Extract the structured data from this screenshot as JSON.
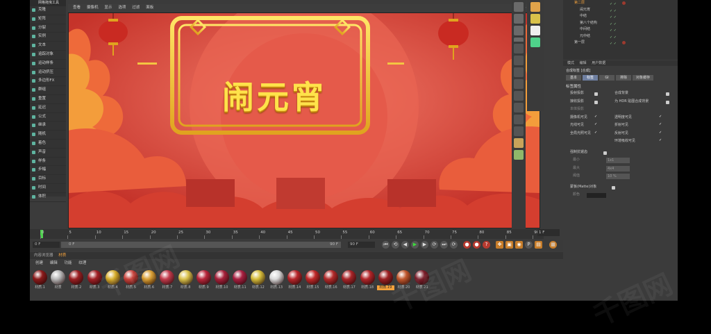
{
  "left_menu": {
    "title": "网格拖曳工具",
    "items": [
      "克隆",
      "矩阵",
      "分裂",
      "实例",
      "文本",
      "追踪对象",
      "运动样条",
      "运动挤压",
      "多边形FX",
      "群组",
      "重置",
      "延迟",
      "公式",
      "继承",
      "随机",
      "着色",
      "声音",
      "样条",
      "步幅",
      "目标",
      "时间",
      "体积"
    ]
  },
  "viewport": {
    "menu": [
      "查看",
      "摄像机",
      "显示",
      "选项",
      "过滤",
      "面板"
    ],
    "title_text": "闹元宵"
  },
  "object_manager": {
    "rows": [
      {
        "name": "第二层",
        "selected": true
      },
      {
        "name": "闹元宵",
        "selected": false
      },
      {
        "name": "中结",
        "selected": false
      },
      {
        "name": "第八个结构",
        "selected": false
      },
      {
        "name": "中间结",
        "selected": false
      },
      {
        "name": "元中结",
        "selected": false
      },
      {
        "name": "第一层",
        "selected": false
      }
    ]
  },
  "attributes": {
    "header_tabs": [
      "模式",
      "编辑",
      "用户数据"
    ],
    "title": "合成标签 [合成]",
    "tabs": [
      "基本",
      "标签",
      "GI",
      "排除",
      "对象缓存"
    ],
    "section": "标签属性",
    "left_props": [
      "投射投影",
      "接收投影",
      "本体投影",
      "摄像机可见",
      "光线可见",
      "全局光照可见"
    ],
    "right_props": [
      "合成背景",
      "为 HDR 贴图合成背景",
      "透明度可见",
      "折射可见",
      "反射可见",
      "环境吸收可见"
    ],
    "lower_props": [
      "强制抗锯齿",
      "最小",
      "最大",
      "阈值"
    ],
    "lower_values": [
      "1x1",
      "4x4",
      "10 %"
    ],
    "matte_label": "蒙板(Matte)对象",
    "color_label": "颜色"
  },
  "timeline": {
    "ticks": [
      "0",
      "5",
      "10",
      "15",
      "20",
      "25",
      "30",
      "35",
      "40",
      "45",
      "50",
      "55",
      "60",
      "65",
      "70",
      "75",
      "80",
      "85",
      "90"
    ],
    "frame_field": "1 F",
    "start_field": "0 F",
    "range_start": "0 F",
    "range_end": "90 F",
    "end_field": "90 F"
  },
  "material_manager": {
    "tabs": [
      "内容浏览器",
      "材质"
    ],
    "menu": [
      "创建",
      "编辑",
      "功能",
      "纹理"
    ],
    "materials": [
      {
        "name": "材质.1",
        "color": "#8b1a1a"
      },
      {
        "name": "材质",
        "color": "#b8b8b8"
      },
      {
        "name": "材质.2",
        "color": "#9b1f22"
      },
      {
        "name": "材质.3",
        "color": "#a11f25"
      },
      {
        "name": "材质.4",
        "color": "#d7ad2a"
      },
      {
        "name": "材质.5",
        "color": "#c9413a"
      },
      {
        "name": "材质.6",
        "color": "#d89b2b"
      },
      {
        "name": "材质.7",
        "color": "#c33a4b"
      },
      {
        "name": "材质.8",
        "color": "#d9c14a"
      },
      {
        "name": "材质.9",
        "color": "#b8253a"
      },
      {
        "name": "材质.10",
        "color": "#a6203a"
      },
      {
        "name": "材质.11",
        "color": "#a81f40"
      },
      {
        "name": "材质.12",
        "color": "#d6bd3a"
      },
      {
        "name": "材质.13",
        "color": "#d9d9d9"
      },
      {
        "name": "材质.14",
        "color": "#b8252a"
      },
      {
        "name": "材质.15",
        "color": "#c02828"
      },
      {
        "name": "材质.16",
        "color": "#b22a2a"
      },
      {
        "name": "材质.17",
        "color": "#a82428"
      },
      {
        "name": "材质.18",
        "color": "#b22529"
      },
      {
        "name": "材质.19",
        "color": "#9c2023"
      },
      {
        "name": "材质.20",
        "color": "#c1572c"
      },
      {
        "name": "材质.21",
        "color": "#7d1e2b"
      }
    ],
    "selected_index": 19
  },
  "watermark": "千图网",
  "accent": "#f4a23c"
}
